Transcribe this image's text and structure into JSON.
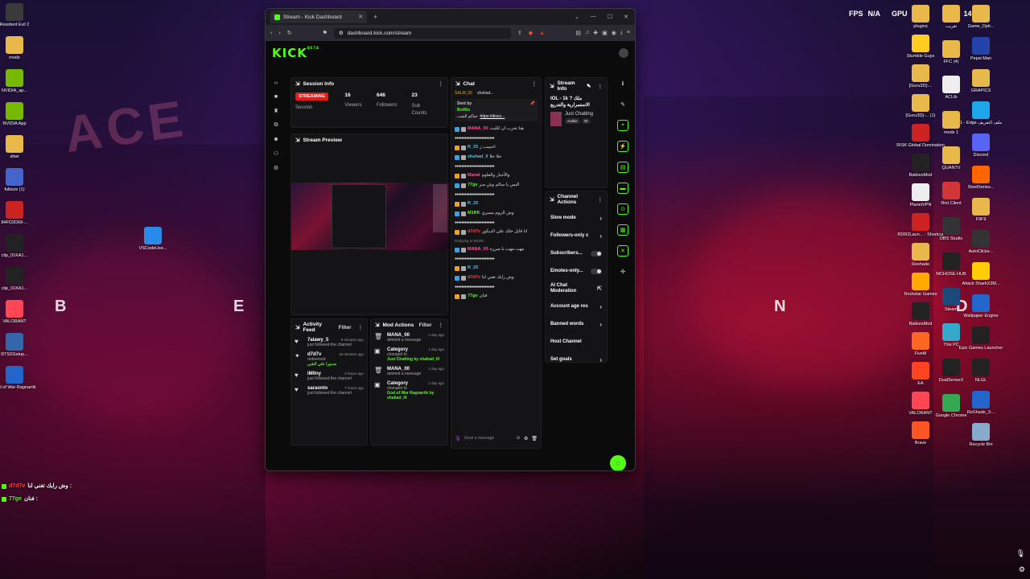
{
  "desktop": {
    "top_right": {
      "fps": "FPS",
      "fps_value": "N/A",
      "gpu": "GPU",
      "gpu_value": "14°"
    },
    "icons_left": [
      {
        "label": "Resident Evil 2",
        "color": "#3a3a3a"
      },
      {
        "label": "mods",
        "color": "#e8b84a"
      },
      {
        "label": "NVIDIA_ap...",
        "color": "#76b900"
      },
      {
        "label": "NVIDIA App",
        "color": "#76b900"
      },
      {
        "label": "sbwi",
        "color": "#e8b84a"
      },
      {
        "label": "fullsize (1)",
        "color": "#4466cc"
      },
      {
        "label": "84FD2D69-...",
        "color": "#cc2222"
      },
      {
        "label": "clip_01KA1...",
        "color": "#222"
      },
      {
        "label": "clip_01KA1...",
        "color": "#222"
      },
      {
        "label": "VALORANT",
        "color": "#ff4655"
      },
      {
        "label": "RTSSSetup...",
        "color": "#3366aa"
      },
      {
        "label": "God of War Ragnarök",
        "color": "#2266cc"
      }
    ],
    "icons_mid": [
      {
        "label": "VSCodeUse...",
        "color": "#2a8ae8"
      }
    ],
    "icons_right_col1": [
      {
        "label": "plugins",
        "color": "#e8b84a"
      },
      {
        "label": "Stumble Guys",
        "color": "#ffcc22"
      },
      {
        "label": "[Guru3D]-...",
        "color": "#e8b84a"
      },
      {
        "label": "[Guru3D]-... (1)",
        "color": "#e8b84a"
      },
      {
        "label": "RISK Global Domination",
        "color": "#cc2222"
      },
      {
        "label": "BakkesMod",
        "color": "#222"
      },
      {
        "label": "PlanetVPN",
        "color": "#eeeeee"
      },
      {
        "label": "RDR2Laun... - Shortcut",
        "color": "#cc2222"
      },
      {
        "label": "Reshade",
        "color": "#e8b84a"
      },
      {
        "label": "Rockstar Games",
        "color": "#ffaa00"
      },
      {
        "label": "BakkesMod",
        "color": "#222"
      },
      {
        "label": "FiveM",
        "color": "#ff6622"
      },
      {
        "label": "EA",
        "color": "#ff4422"
      },
      {
        "label": "VALORANT",
        "color": "#ff4655"
      },
      {
        "label": "Brave",
        "color": "#ff5522"
      }
    ],
    "icons_right_col2": [
      {
        "label": "تقریب",
        "color": "#e8b84a"
      },
      {
        "label": "FFC (4)",
        "color": "#e8b84a"
      },
      {
        "label": "ACLib",
        "color": "#eeeeee"
      },
      {
        "label": "mods 1",
        "color": "#e8b84a"
      },
      {
        "label": "QUANTV",
        "color": "#e8b84a"
      },
      {
        "label": "Riot Client",
        "color": "#d13639"
      },
      {
        "label": "OBS Studio",
        "color": "#333"
      },
      {
        "label": "MCHOSE HUB",
        "color": "#222"
      },
      {
        "label": "Steam",
        "color": "#1b4a7a"
      },
      {
        "label": "This PC",
        "color": "#33aacc"
      },
      {
        "label": "DualSenseX",
        "color": "#222"
      },
      {
        "label": "Google Chrome",
        "color": "#34a853"
      }
    ],
    "icons_right_col3": [
      {
        "label": "Game_Opti...",
        "color": "#e8b84a"
      },
      {
        "label": "Pepsi Man",
        "color": "#2244aa"
      },
      {
        "label": "GRAPICS",
        "color": "#e8b84a"
      },
      {
        "label": "1 - Edge ملف التعريف",
        "color": "#1ea7e8"
      },
      {
        "label": "Discord",
        "color": "#5865f2"
      },
      {
        "label": "SteelSeries...",
        "color": "#ff6600"
      },
      {
        "label": "F9F9",
        "color": "#e8b84a"
      },
      {
        "label": "AutoClicke...",
        "color": "#333"
      },
      {
        "label": "Attack SharkX3M...",
        "color": "#ffcc00"
      },
      {
        "label": "Wallpaper Engine",
        "color": "#2266cc"
      },
      {
        "label": "Epic Games Launcher",
        "color": "#222"
      },
      {
        "label": "NLGL",
        "color": "#222"
      },
      {
        "label": "ReShade_S...",
        "color": "#2266cc"
      },
      {
        "label": "Recycle Bin",
        "color": "#88aacc"
      }
    ],
    "overlay_chat": [
      {
        "user": "d7d7v",
        "text": "وش رايك تغني لنا :"
      },
      {
        "user": "77ge",
        "text": "فنان :"
      }
    ]
  },
  "browser": {
    "tab_title": "Stream - Kick Dashboard",
    "url": "dashboard.kick.com/stream"
  },
  "kick": {
    "logo": "KICK",
    "beta": "BETA",
    "session": {
      "title": "Session Info",
      "status": "STREAMING",
      "status_label": "Session",
      "viewers": "16",
      "viewers_label": "Viewers",
      "followers": "646",
      "followers_label": "Followers",
      "subs": "23",
      "subs_label": "Sub Counts"
    },
    "preview_title": "Stream Preview",
    "chat": {
      "title": "Chat",
      "pinned_users": [
        "SALM_55",
        "shahad..."
      ],
      "sent_by": "Sent by",
      "bot": "BotRix",
      "pin_text": "حياكم الشب",
      "pin_link": "https://disco...",
      "messages": [
        {
          "user": "MANA_00",
          "ucls": "u-p",
          "text": "هنا تحرب ان لللبث"
        },
        {
          "user": "R_25",
          "ucls": "u-c",
          "text": "احبببب ز"
        },
        {
          "user": "shahad_ll",
          "ucls": "u-c",
          "text": "حلا حلا"
        },
        {
          "user": "Manal",
          "ucls": "u-p",
          "text": "والأحبار والعلوم"
        },
        {
          "user": "77ge",
          "ucls": "u-g",
          "text": "البس يا سالم وش سر"
        },
        {
          "user": "R_25",
          "ucls": "u-c",
          "text": ""
        },
        {
          "user": "M1RK",
          "ucls": "u-g",
          "text": "وش الروم مسري"
        },
        {
          "user": "d7d7v",
          "ucls": "u-r",
          "text": "انا قايل خلك على الديكور"
        },
        {
          "user": "MANA_00",
          "ucls": "u-p",
          "text": "مهب مهب با سرزه"
        },
        {
          "user": "R_25",
          "ucls": "u-c",
          "text": ""
        },
        {
          "user": "d7d7v",
          "ucls": "u-r",
          "text": "وش رايك تغني لنا"
        },
        {
          "user": "77ge",
          "ucls": "u-g",
          "text": "فنان"
        }
      ],
      "replying_to": "Replying to M1RK:",
      "send_placeholder": "Send a message"
    },
    "stream_info": {
      "title": "Stream Info",
      "stream_title": "IOL - 1k ? ملك",
      "stream_subtitle": "الاستمرارية والتدريع",
      "category": "Just Chatting",
      "tags": [
        "Arabic",
        "Ot"
      ]
    },
    "channel_actions": {
      "title": "Channel Actions",
      "rows": [
        {
          "label": "Slow mode",
          "kind": "chev"
        },
        {
          "label": "Followers-only c",
          "kind": "chev"
        },
        {
          "label": "Subscribers...",
          "kind": "toggle"
        },
        {
          "label": "Emotes-only...",
          "kind": "toggle"
        },
        {
          "label": "AI Chat Moderation",
          "kind": "ext"
        },
        {
          "label": "Account age res",
          "kind": "chev"
        },
        {
          "label": "Banned words",
          "kind": "chev"
        },
        {
          "label": "Host Channel",
          "kind": "none"
        },
        {
          "label": "Set goals",
          "kind": "chev"
        }
      ]
    },
    "activity": {
      "title": "Activity Feed",
      "filter": "Filter",
      "items": [
        {
          "icon": "heart-icon",
          "glyph": "♥",
          "name": "7alawy_5",
          "time": "6 minutes ago",
          "desc": "just followed the channel",
          "extra": ""
        },
        {
          "icon": "gift-icon",
          "glyph": "✦",
          "name": "d7d7v",
          "time": "16 minutes ago",
          "desc": "redeemed",
          "extra": "صدورا علي الشي"
        },
        {
          "icon": "heart-icon",
          "glyph": "♥",
          "name": "iM0ny",
          "time": "2 hours ago",
          "desc": "just followed the channel",
          "extra": ""
        },
        {
          "icon": "heart-icon",
          "glyph": "♥",
          "name": "saraonto",
          "time": "7 hours ago",
          "desc": "just followed the channel",
          "extra": ""
        }
      ]
    },
    "mod_actions": {
      "title": "Mod Actions",
      "filter": "Filter",
      "items": [
        {
          "icon": "trash-icon",
          "glyph": "🗑",
          "name": "MANA_00",
          "time": "1 day ago",
          "desc": "deleted a message",
          "extra": ""
        },
        {
          "icon": "category-icon",
          "glyph": "▣",
          "name": "Category",
          "time": "1 day ago",
          "desc": "changed to",
          "extra": "Just Chatting by shahad_lll"
        },
        {
          "icon": "trash-icon",
          "glyph": "🗑",
          "name": "MANA_00",
          "time": "1 day ago",
          "desc": "deleted a message",
          "extra": ""
        },
        {
          "icon": "category-icon",
          "glyph": "▣",
          "name": "Category",
          "time": "1 day ago",
          "desc": "changed to",
          "extra": "God of War Ragnarök by shahad_lll"
        }
      ]
    }
  }
}
